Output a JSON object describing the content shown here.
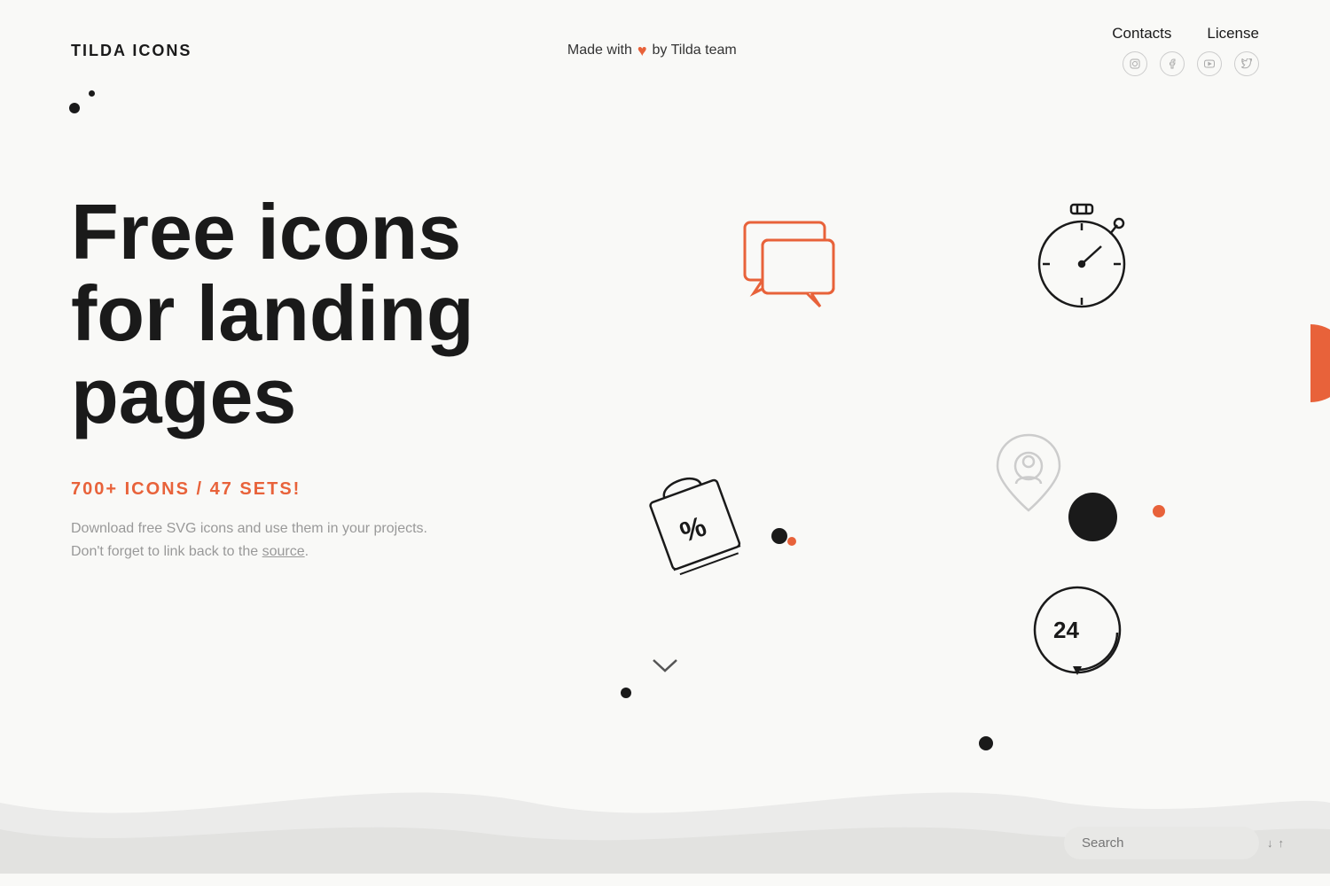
{
  "header": {
    "logo": "TILDA ICONS",
    "tagline_made": "Made with",
    "tagline_by": "by Tilda team",
    "nav": {
      "contacts": "Contacts",
      "license": "License"
    },
    "social": [
      "instagram",
      "facebook",
      "youtube",
      "twitter"
    ]
  },
  "hero": {
    "title_line1": "Free icons",
    "title_line2": "for landing pages",
    "stats": "700+ ICONS / 47 SETS!",
    "desc_line1": "Download free SVG icons and use them in your projects.",
    "desc_line2": "Don't forget to link back to the",
    "source_label": "source",
    "desc_end": "."
  },
  "search": {
    "placeholder": "Search",
    "arrow_down": "↓",
    "arrow_up": "↑"
  },
  "colors": {
    "orange": "#e8623a",
    "black": "#1a1a1a",
    "bg": "#f9f9f7"
  }
}
